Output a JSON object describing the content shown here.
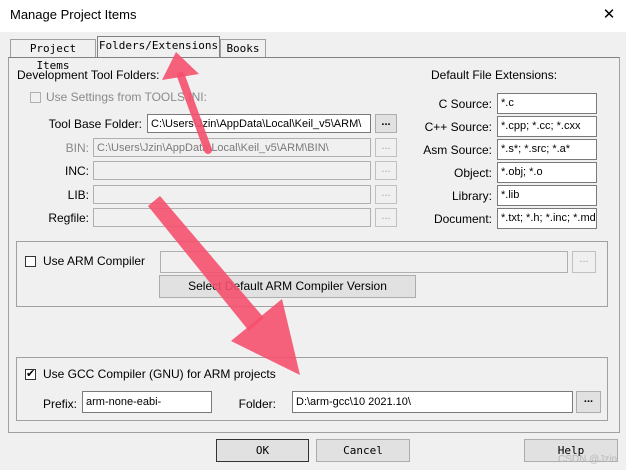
{
  "window": {
    "title": "Manage Project Items",
    "close_glyph": "✕"
  },
  "tabs": [
    {
      "label": "Project Items",
      "active": false
    },
    {
      "label": "Folders/Extensions",
      "active": true
    },
    {
      "label": "Books",
      "active": false
    }
  ],
  "dev_tool_folders": {
    "heading": "Development Tool Folders:",
    "use_settings_label": "Use Settings from TOOLS.INI:",
    "use_settings_checked": false,
    "tool_base_label": "Tool Base Folder:",
    "tool_base_value": "C:\\Users\\Jzin\\AppData\\Local\\Keil_v5\\ARM\\",
    "bin_label": "BIN:",
    "bin_value": "C:\\Users\\Jzin\\AppData\\Local\\Keil_v5\\ARM\\BIN\\",
    "inc_label": "INC:",
    "inc_value": "",
    "lib_label": "LIB:",
    "lib_value": "",
    "regfile_label": "Regfile:",
    "regfile_value": "",
    "browse_label": "..."
  },
  "default_extensions": {
    "heading": "Default File Extensions:",
    "rows": [
      {
        "label": "C Source:",
        "value": "*.c"
      },
      {
        "label": "C++ Source:",
        "value": "*.cpp; *.cc; *.cxx"
      },
      {
        "label": "Asm Source:",
        "value": "*.s*; *.src; *.a*"
      },
      {
        "label": "Object:",
        "value": "*.obj; *.o"
      },
      {
        "label": "Library:",
        "value": "*.lib"
      },
      {
        "label": "Document:",
        "value": "*.txt; *.h; *.inc; *.md"
      }
    ]
  },
  "arm_compiler": {
    "use_label": "Use ARM Compiler",
    "checked": false,
    "path_value": "",
    "browse_label": "...",
    "select_button_label": "Select Default ARM Compiler Version"
  },
  "gcc": {
    "use_label": "Use GCC Compiler (GNU) for ARM projects",
    "checked": true,
    "check_glyph": "✔",
    "prefix_label": "Prefix:",
    "prefix_value": "arm-none-eabi-",
    "folder_label": "Folder:",
    "folder_value": "D:\\arm-gcc\\10 2021.10\\",
    "browse_label": "..."
  },
  "buttons": {
    "ok": "OK",
    "cancel": "Cancel",
    "help": "Help"
  },
  "watermark": "CSDN @Jzin",
  "colors": {
    "annotation_arrow": "#f5506e",
    "window_bg": "#f0f0f0"
  }
}
